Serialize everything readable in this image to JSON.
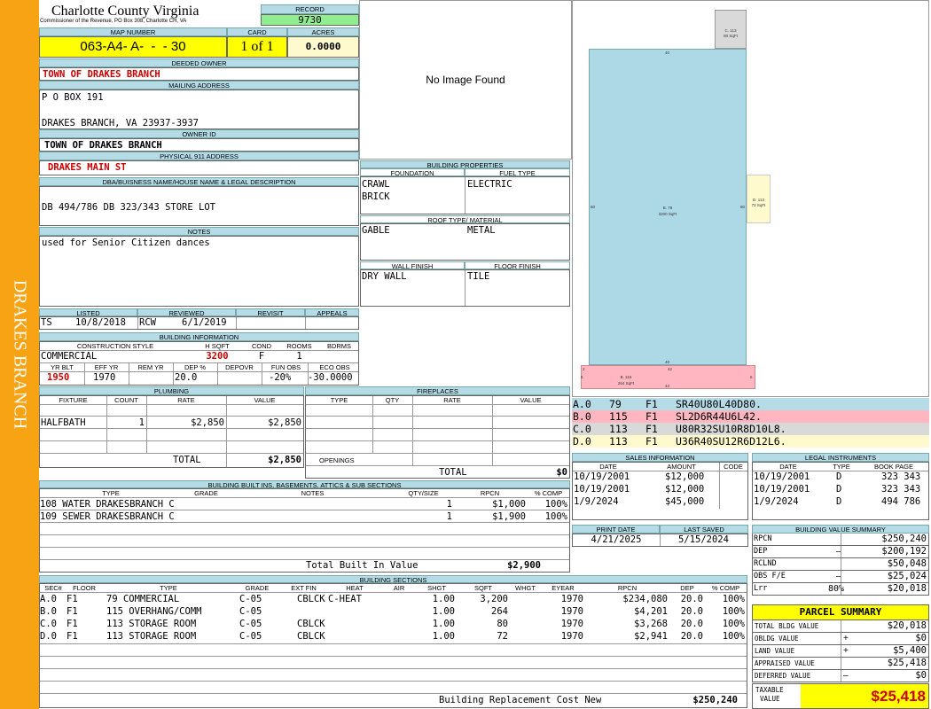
{
  "sidebar": {
    "label": "DRAKES BRANCH"
  },
  "header": {
    "county": "Charlotte County Virginia",
    "commissioner": "Commissioner of the Revenue, PO Box 308, Charlotte CH, VA",
    "record_label": "RECORD",
    "record": "9730",
    "map_label": "MAP NUMBER",
    "map": "063-A4- A-  -  - 30",
    "card_label": "CARD",
    "card": "1 of 1",
    "acres_label": "ACRES",
    "acres": "0.0000"
  },
  "owner": {
    "deeded_label": "DEEDED OWNER",
    "deeded": "TOWN OF DRAKES BRANCH",
    "mailing_label": "MAILING ADDRESS",
    "mailing1": "P O BOX 191",
    "mailing2": "DRAKES BRANCH, VA 23937-3937",
    "owner_id_label": "OWNER ID",
    "owner_id": "TOWN OF DRAKES BRANCH",
    "physical_label": "PHYSICAL 911 ADDRESS",
    "physical": "DRAKES MAIN ST",
    "legal_label": "DBA/BUISNESS NAME/HOUSE NAME & LEGAL DESCRIPTION",
    "legal": "DB 494/786 DB 323/343 STORE LOT",
    "notes_label": "NOTES",
    "notes": "used for Senior Citizen dances"
  },
  "image": {
    "text": "No Image Found"
  },
  "props": {
    "title": "BUILDING PROPERTIES",
    "foundation_label": "FOUNDATION",
    "fuel_label": "FUEL TYPE",
    "foundation1": "CRAWL",
    "foundation2": "BRICK",
    "fuel": "ELECTRIC",
    "roof_label": "ROOF TYPE/ MATERIAL",
    "roof_type": "GABLE",
    "roof_mat": "METAL",
    "wall_label": "WALL FINISH",
    "floor_label": "FLOOR FINISH",
    "wall": "DRY WALL",
    "floor": "TILE"
  },
  "sketch": {
    "top_box": "C. 113",
    "top_box2": "80 SqFt",
    "main_lbl": "B. 79",
    "main_lbl2": "3200 SqFt",
    "right_box": "D. 113",
    "right_box2": "72 SqFt",
    "bot_box": "B. 115",
    "bot_box2": "264 SqFt",
    "d40a": "40",
    "d40b": "40",
    "d80a": "80",
    "d80b": "80",
    "d42": "42",
    "d44": "44",
    "d2": "2",
    "d6a": "6",
    "d6b": "6"
  },
  "review": {
    "listed_label": "LISTED",
    "reviewed_label": "REVIEWED",
    "revisit_label": "REVISIT",
    "appeals_label": "APPEALS",
    "listed_by": "TS",
    "listed_date": "10/8/2018",
    "reviewed_by": "RCW",
    "reviewed_date": "6/1/2019"
  },
  "bldg": {
    "title": "BUILDING INFORMATION",
    "style_label": "CONSTRUCTION STYLE",
    "hsqft_label": "H SQFT",
    "cond_label": "COND",
    "rooms_label": "ROOMS",
    "bdrms_label": "BDRMS",
    "style": "COMMERCIAL",
    "hsqft": "3200",
    "cond": "F",
    "rooms": "1",
    "yrblt_label": "YR BLT",
    "effyr_label": "EFF YR",
    "remyr_label": "REM YR",
    "dep_label": "DEP %",
    "depovr_label": "DEPOVR",
    "funobs_label": "FUN OBS",
    "ecoobs_label": "ECO OBS",
    "yrblt": "1950",
    "effyr": "1970",
    "dep": "20.0",
    "funobs": "-20%",
    "ecoobs": "-30.0000"
  },
  "codes": [
    {
      "code": "A.0",
      "n": "79",
      "f": "F1",
      "s": "SR40U80L40D80."
    },
    {
      "code": "B.0",
      "n": "115",
      "f": "F1",
      "s": "SL2D6R44U6L42."
    },
    {
      "code": "C.0",
      "n": "113",
      "f": "F1",
      "s": "U80R32SU10R8D10L8."
    },
    {
      "code": "D.0",
      "n": "113",
      "f": "F1",
      "s": "U36R40SU12R6D12L6."
    }
  ],
  "code_colors": [
    "#b5dce6",
    "#ffb6c1",
    "#d9d9d9",
    "#fffacd"
  ],
  "plumbing": {
    "title": "PLUMBING",
    "h_fixture": "FIXTURE",
    "h_count": "COUNT",
    "h_rate": "RATE",
    "h_value": "VALUE",
    "fixture": "HALFBATH",
    "count": "1",
    "rate": "$2,850",
    "value": "$2,850",
    "total_label": "TOTAL",
    "total": "$2,850"
  },
  "fireplaces": {
    "title": "FIREPLACES",
    "h_type": "TYPE",
    "h_qty": "QTY",
    "h_rate": "RATE",
    "h_value": "VALUE",
    "openings": "OPENINGS",
    "total_label": "TOTAL",
    "total": "$0"
  },
  "sales": {
    "title": "SALES INFORMATION",
    "h_date": "DATE",
    "h_amount": "AMOUNT",
    "h_code": "CODE",
    "rows": [
      {
        "date": "10/19/2001",
        "amount": "$12,000"
      },
      {
        "date": "10/19/2001",
        "amount": "$12,000"
      },
      {
        "date": "1/9/2024",
        "amount": "$45,000"
      }
    ]
  },
  "legal_instr": {
    "title": "LEGAL INSTRUMENTS",
    "h_date": "DATE",
    "h_type": "TYPE",
    "h_book": "BOOK PAGE",
    "rows": [
      {
        "date": "10/19/2001",
        "type": "D",
        "book": "323 343"
      },
      {
        "date": "10/19/2001",
        "type": "D",
        "book": "323 343"
      },
      {
        "date": "1/9/2024",
        "type": "D",
        "book": "494 786"
      }
    ]
  },
  "print": {
    "print_label": "PRINT DATE",
    "saved_label": "LAST SAVED",
    "print_date": "4/21/2025",
    "saved_date": "5/15/2024"
  },
  "builtins": {
    "title": "BUILDING BUILT INS, BASEMENTS, ATTICS & SUB SECTIONS",
    "h_type": "TYPE",
    "h_grade": "GRADE",
    "h_notes": "NOTES",
    "h_qty": "QTY/SIZE",
    "h_rpcn": "RPCN",
    "h_comp": "% COMP",
    "rows": [
      {
        "type": "108 WATER DRAKESBRANCH C",
        "qty": "1",
        "rpcn": "$1,000",
        "comp": "100%"
      },
      {
        "type": "109 SEWER DRAKESBRANCH C",
        "qty": "1",
        "rpcn": "$1,900",
        "comp": "100%"
      }
    ],
    "total_label": "Total Built In Value",
    "total": "$2,900"
  },
  "sections": {
    "title": "BUILDING SECTIONS",
    "h": [
      "SEC#",
      "FLOOR",
      "TYPE",
      "GRADE",
      "EXT FIN",
      "HEAT",
      "AIR",
      "SHGT",
      "SQFT",
      "WHGT",
      "EYEAR",
      "RPCN",
      "DEP",
      "% COMP"
    ],
    "rows": [
      [
        "A.0",
        "F1",
        "79 COMMERCIAL",
        "C-05",
        "CBLCK",
        "C-HEAT",
        "",
        "1.00",
        "3,200",
        "",
        "1970",
        "$234,080",
        "20.0",
        "100%"
      ],
      [
        "B.0",
        "F1",
        "115 OVERHANG/COMM",
        "C-05",
        "",
        "",
        "",
        "1.00",
        "264",
        "",
        "1970",
        "$4,201",
        "20.0",
        "100%"
      ],
      [
        "C.0",
        "F1",
        "113 STORAGE ROOM",
        "C-05",
        "CBLCK",
        "",
        "",
        "1.00",
        "80",
        "",
        "1970",
        "$3,268",
        "20.0",
        "100%"
      ],
      [
        "D.0",
        "F1",
        "113 STORAGE ROOM",
        "C-05",
        "CBLCK",
        "",
        "",
        "1.00",
        "72",
        "",
        "1970",
        "$2,941",
        "20.0",
        "100%"
      ]
    ],
    "total_label": "Building Replacement Cost New",
    "total": "$250,240"
  },
  "value_summary": {
    "title": "BUILDING VALUE SUMMARY",
    "rows": [
      {
        "label": "RPCN",
        "sign": "",
        "value": "$250,240"
      },
      {
        "label": "DEP",
        "sign": "–",
        "value": "$200,192"
      },
      {
        "label": "RCLND",
        "sign": "",
        "value": "$50,048"
      },
      {
        "label": "OBS F/E",
        "sign": "–",
        "value": "$25,024"
      },
      {
        "label": "Lrr",
        "sign": "80%",
        "value": "$20,018"
      }
    ]
  },
  "parcel": {
    "title": "PARCEL SUMMARY",
    "rows": [
      {
        "label": "TOTAL BLDG VALUE",
        "sign": "",
        "value": "$20,018"
      },
      {
        "label": "OBLDG VALUE",
        "sign": "+",
        "value": "$0"
      },
      {
        "label": "LAND VALUE",
        "sign": "+",
        "value": "$5,400"
      },
      {
        "label": "APPRAISED VALUE",
        "sign": "",
        "value": "$25,418"
      },
      {
        "label": "DEFERRED VALUE",
        "sign": "–",
        "value": "$0"
      }
    ],
    "taxable_label1": "TAXABLE",
    "taxable_label2": "VALUE",
    "taxable": "$25,418"
  }
}
